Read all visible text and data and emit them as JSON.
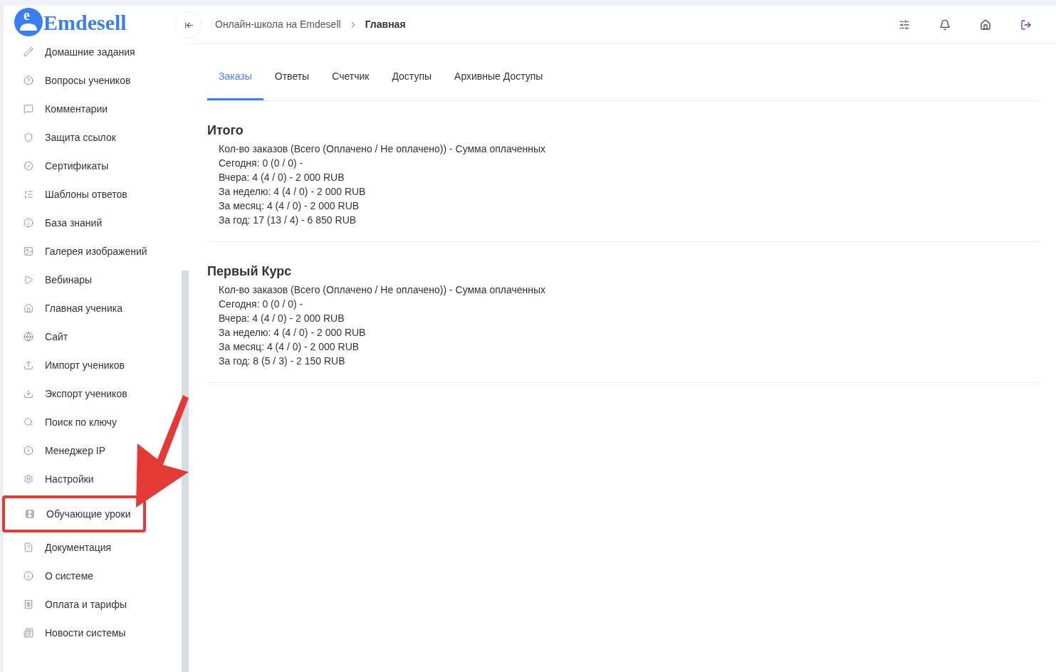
{
  "logo": {
    "letter": "e",
    "name": "Emdesell"
  },
  "sidebar": {
    "items": [
      {
        "label": "Домашние задания",
        "highlighted": false
      },
      {
        "label": "Вопросы учеников",
        "highlighted": false
      },
      {
        "label": "Комментарии",
        "highlighted": false
      },
      {
        "label": "Защита ссылок",
        "highlighted": false
      },
      {
        "label": "Сертификаты",
        "highlighted": false
      },
      {
        "label": "Шаблоны ответов",
        "highlighted": false
      },
      {
        "label": "База знаний",
        "highlighted": false
      },
      {
        "label": "Галерея изображений",
        "highlighted": false
      },
      {
        "label": "Вебинары",
        "highlighted": false
      },
      {
        "label": "Главная ученика",
        "highlighted": false
      },
      {
        "label": "Сайт",
        "highlighted": false
      },
      {
        "label": "Импорт учеников",
        "highlighted": false
      },
      {
        "label": "Экспорт учеников",
        "highlighted": false
      },
      {
        "label": "Поиск по ключу",
        "highlighted": false
      },
      {
        "label": "Менеджер IP",
        "highlighted": false
      },
      {
        "label": "Настройки",
        "highlighted": false
      },
      {
        "label": "Обучающие уроки",
        "highlighted": true
      },
      {
        "label": "Документация",
        "highlighted": false
      },
      {
        "label": "О системе",
        "highlighted": false
      },
      {
        "label": "Оплата и тарифы",
        "highlighted": false
      },
      {
        "label": "Новости системы",
        "highlighted": false
      }
    ]
  },
  "breadcrumbs": [
    {
      "label": "Онлайн-школа на Emdesell",
      "current": false
    },
    {
      "label": "Главная",
      "current": true
    }
  ],
  "tabs": [
    {
      "label": "Заказы",
      "selected": true
    },
    {
      "label": "Ответы",
      "selected": false
    },
    {
      "label": "Счетчик",
      "selected": false
    },
    {
      "label": "Доступы",
      "selected": false
    },
    {
      "label": "Архивные Доступы",
      "selected": false
    }
  ],
  "sections": [
    {
      "title": "Итого",
      "lines": [
        "Кол-во заказов (Всего (Оплачено / Не оплачено)) - Сумма оплаченных",
        "Сегодня: 0 (0 / 0) -",
        "Вчера: 4 (4 / 0) - 2 000 RUB",
        "За неделю: 4 (4 / 0) - 2 000 RUB",
        "За месяц: 4 (4 / 0) - 2 000 RUB",
        "За год: 17 (13 / 4) - 6 850 RUB"
      ]
    },
    {
      "title": "Первый Курс",
      "lines": [
        "Кол-во заказов (Всего (Оплачено / Не оплачено)) - Сумма оплаченных",
        "Сегодня: 0 (0 / 0) -",
        "Вчера: 4 (4 / 0) - 2 000 RUB",
        "За неделю: 4 (4 / 0) - 2 000 RUB",
        "За месяц: 4 (4 / 0) - 2 000 RUB",
        "За год: 8 (5 / 3) - 2 150 RUB"
      ]
    }
  ]
}
